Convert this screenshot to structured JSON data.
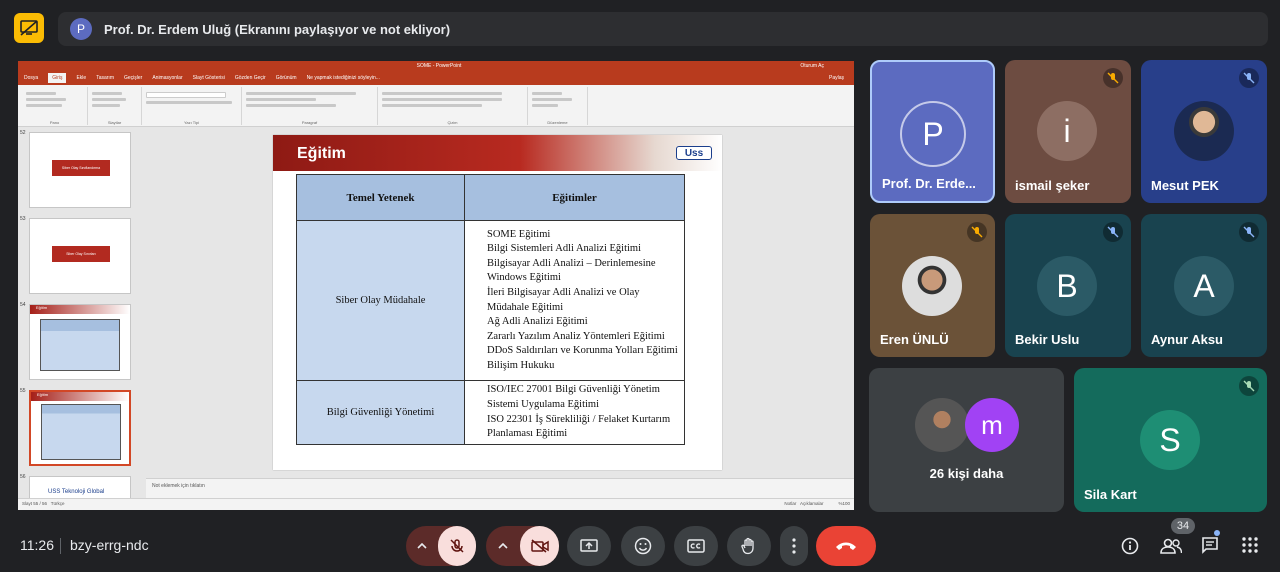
{
  "banner": {
    "initial": "P",
    "text": "Prof. Dr. Erdem Uluğ (Ekranını paylaşıyor ve not ekliyor)"
  },
  "ppt": {
    "window_title": "SOME - PowerPoint",
    "tabs": [
      "Dosya",
      "Giriş",
      "Ekle",
      "Tasarım",
      "Geçişler",
      "Animasyonlar",
      "Slayt Gösterisi",
      "Gözden Geçir",
      "Görünüm",
      "Ne yapmak istediğinizi söyleyin..."
    ],
    "active_tab": "Giriş",
    "account": "Oturum Aç",
    "share": "Paylaş",
    "ribbon_groups": [
      "Pano",
      "Slaytlar",
      "Yazı Tipi",
      "Paragraf",
      "Çizim",
      "Düzenleme"
    ],
    "thumb_numbers": [
      "52",
      "53",
      "54",
      "55",
      "56"
    ],
    "thumb_titles": [
      "Siber Olay Sınıflandırma",
      "Siber Olay Sınırları",
      "Eğitim",
      "Eğitim",
      "USS Teknoloji Global"
    ],
    "notes_placeholder": "Not eklemek için tıklatın",
    "status_left": "Slayt 55 / 56",
    "status_lang": "Türkçe",
    "status_notes": "Notlar",
    "status_comments": "Açıklamalar",
    "zoom": "%100"
  },
  "slide": {
    "title": "Eğitim",
    "logo": "Uss",
    "table": {
      "headers": [
        "Temel Yetenek",
        "Eğitimler"
      ],
      "rows": [
        {
          "skill": "Siber Olay Müdahale",
          "trainings": [
            "SOME Eğitimi",
            "Bilgi Sistemleri Adli Analizi Eğitimi",
            "Bilgisayar Adli Analizi – Derinlemesine Windows Eğitimi",
            "İleri Bilgisayar Adli Analizi ve Olay Müdahale Eğitimi",
            "Ağ Adli Analizi Eğitimi",
            "Zararlı Yazılım Analiz Yöntemleri Eğitimi",
            "DDoS Saldırıları ve Korunma Yolları Eğitimi",
            "Bilişim Hukuku"
          ]
        },
        {
          "skill": "Bilgi Güvenliği Yönetimi",
          "trainings": [
            "ISO/IEC 27001 Bilgi Güvenliği Yönetim Sistemi Uygulama Eğitimi",
            "ISO 22301 İş Sürekliliği / Felaket Kurtarım Planlaması Eğitimi"
          ]
        }
      ]
    }
  },
  "participants": [
    {
      "name": "Prof. Dr. Erde...",
      "initial": "P",
      "muted": false
    },
    {
      "name": "ismail şeker",
      "initial": "i",
      "muted": true
    },
    {
      "name": "Mesut PEK",
      "initial": "",
      "muted": true
    },
    {
      "name": "Eren ÜNLÜ",
      "initial": "",
      "muted": true
    },
    {
      "name": "Bekir Uslu",
      "initial": "B",
      "muted": true
    },
    {
      "name": "Aynur Aksu",
      "initial": "A",
      "muted": true
    },
    {
      "name": "26 kişi daha",
      "initial": "m",
      "muted": false
    },
    {
      "name": "Sila Kart",
      "initial": "S",
      "muted": true
    }
  ],
  "bottom": {
    "time": "11:26",
    "meeting_code": "bzy-errg-ndc",
    "people_count": "34"
  },
  "colors": {
    "end_call": "#ea4335",
    "muted_button": "#f9dedc",
    "present_icon": "#fbbc04"
  }
}
